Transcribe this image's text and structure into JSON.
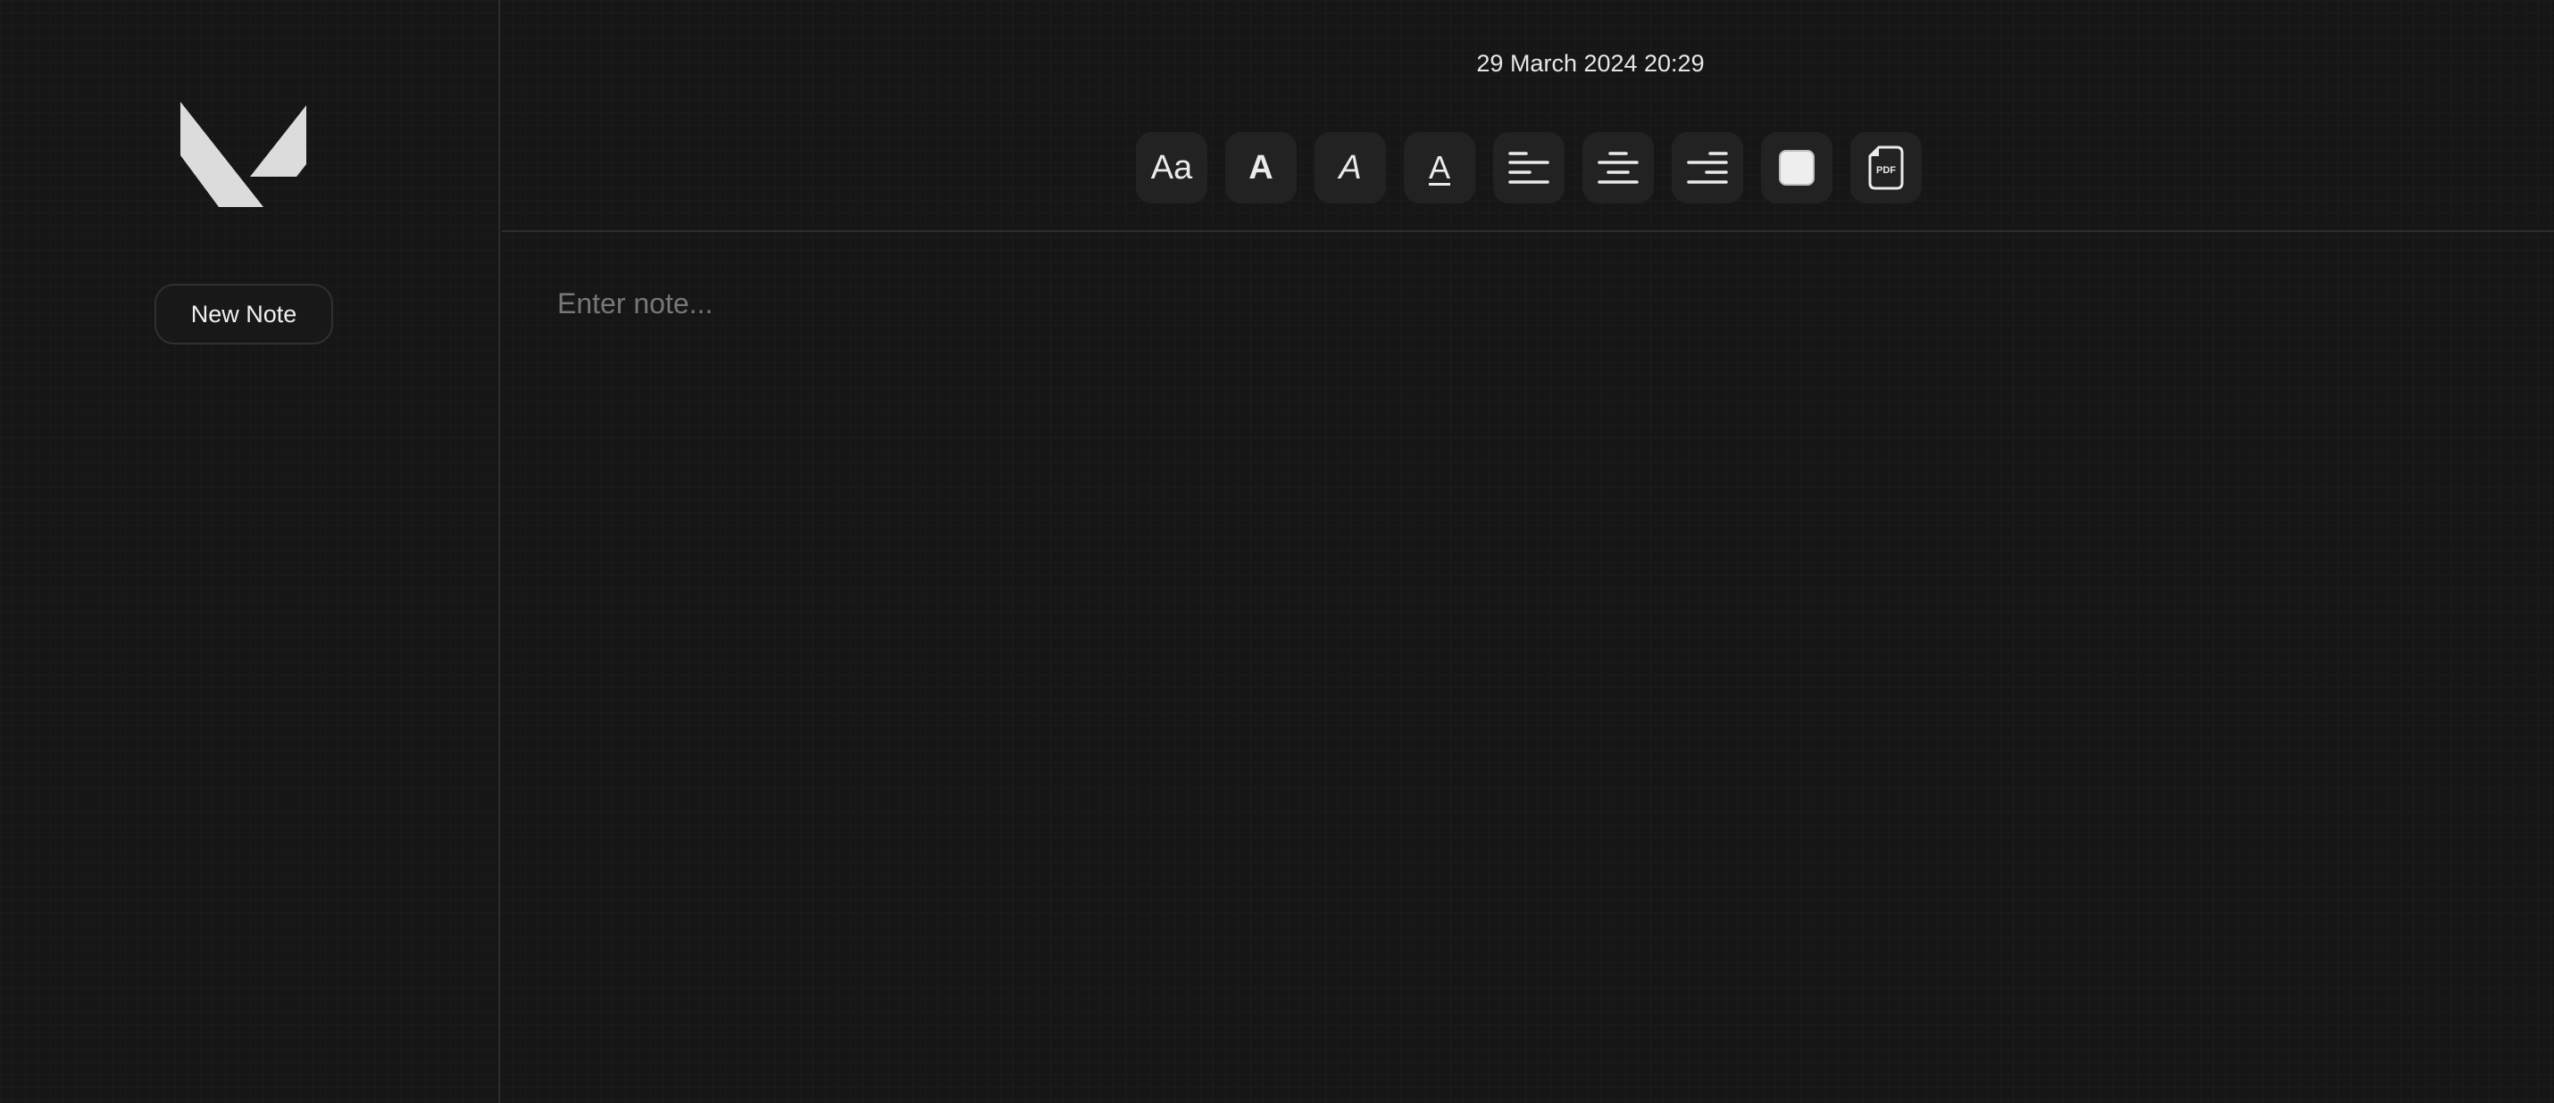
{
  "sidebar": {
    "logo_icon": "valorant-v-logo",
    "new_note_label": "New Note"
  },
  "header": {
    "datetime": "29 March 2024 20:29"
  },
  "toolbar": {
    "font_size_label": "Aa",
    "bold_label": "A",
    "italic_label": "A",
    "underline_label": "A",
    "icons": [
      "font-size-icon",
      "bold-icon",
      "italic-icon",
      "underline-icon",
      "align-left-icon",
      "align-center-icon",
      "align-right-icon",
      "color-swatch-icon",
      "pdf-export-icon"
    ],
    "pdf_label": "PDF",
    "swatch_color": "#eeeeee"
  },
  "editor": {
    "placeholder": "Enter note...",
    "value": ""
  },
  "colors": {
    "background": "#161616",
    "button_bg": "#222222",
    "text": "#e6e6e6",
    "placeholder": "#777777"
  }
}
